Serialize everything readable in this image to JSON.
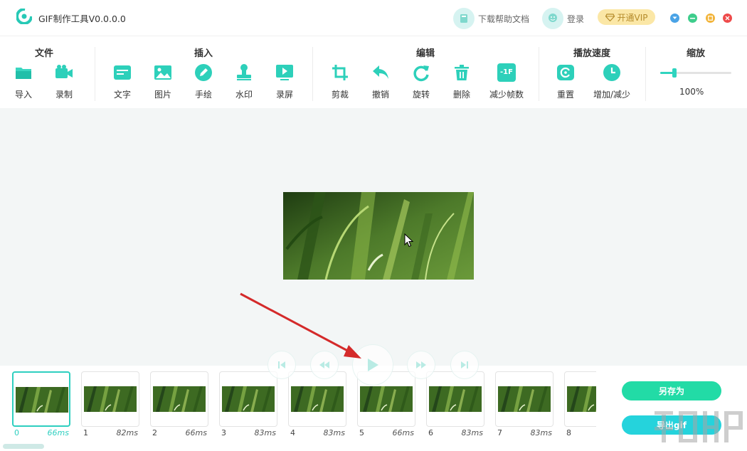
{
  "app": {
    "title": "GIF制作工具V0.0.0.0"
  },
  "header": {
    "help_label": "下载帮助文档",
    "login_label": "登录",
    "vip_label": "开通VIP"
  },
  "colors": {
    "accent": "#2ecfc0",
    "green_button": "#22dba6",
    "cyan_button": "#25d3dc",
    "vip_bg": "#fbe7a6"
  },
  "toolbar": {
    "groups": {
      "file": "文件",
      "insert": "插入",
      "edit": "编辑",
      "speed": "播放速度",
      "zoom": "缩放"
    },
    "file": {
      "import": "导入",
      "record": "录制"
    },
    "insert": {
      "text": "文字",
      "image": "图片",
      "draw": "手绘",
      "watermark": "水印",
      "screen": "录屏"
    },
    "edit": {
      "crop": "剪裁",
      "undo": "撤销",
      "rotate": "旋转",
      "delete": "删除",
      "reduce": "减少帧数",
      "reduce_icon_text": "-1F"
    },
    "speed": {
      "reset": "重置",
      "adjust": "增加/减少"
    },
    "zoom": {
      "value_label": "100%",
      "level_fraction": 0.2
    }
  },
  "frames": [
    {
      "index": "0",
      "duration": "66ms",
      "selected": true
    },
    {
      "index": "1",
      "duration": "82ms"
    },
    {
      "index": "2",
      "duration": "66ms"
    },
    {
      "index": "3",
      "duration": "83ms"
    },
    {
      "index": "4",
      "duration": "83ms"
    },
    {
      "index": "5",
      "duration": "66ms"
    },
    {
      "index": "6",
      "duration": "83ms"
    },
    {
      "index": "7",
      "duration": "83ms"
    },
    {
      "index": "8",
      "duration": ""
    }
  ],
  "actions": {
    "save_as": "另存为",
    "export_gif": "导出gif"
  }
}
